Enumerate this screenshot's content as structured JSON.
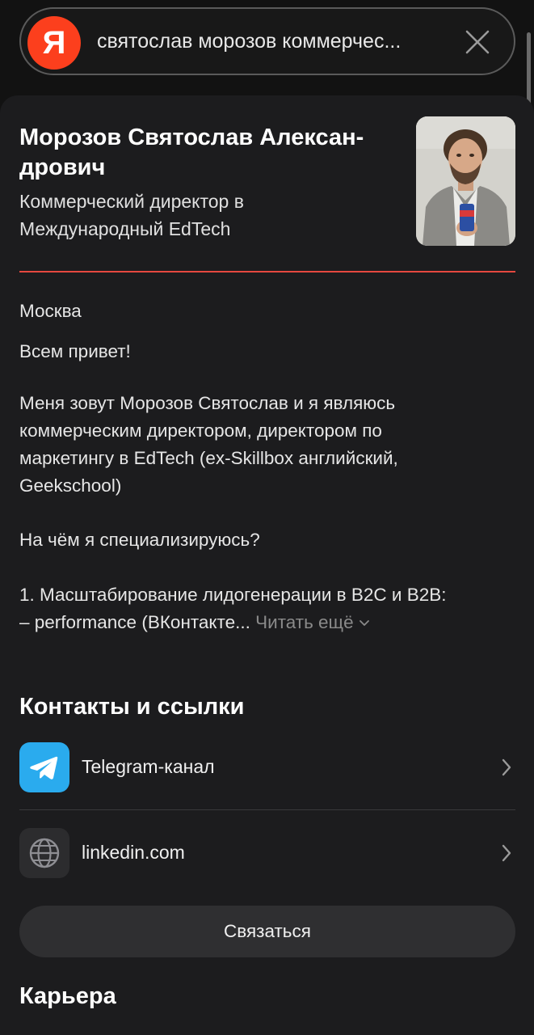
{
  "search": {
    "logo_letter": "Я",
    "query": "святослав морозов коммерчес..."
  },
  "profile": {
    "name": "Морозов Святослав Алексан-дрович",
    "name_line1": "Морозов Святослав Алексан-",
    "name_line2": "дрович",
    "role_line1": "Коммерческий директор в",
    "role_line2": "Международный EdTech",
    "city": "Москва",
    "greeting": "Всем привет!",
    "bio_lines": [
      "Меня зовут Морозов Святослав и я являюсь",
      "коммерческим директором, директором по",
      "маркетингу в EdTech (ex-Skillbox английский,",
      "Geekschool)"
    ],
    "question": "На чём я специализируюсь?",
    "point_line1": "1. Масштабирование лидогенерации в B2C и B2B:",
    "point_line2": "– performance (ВКонтакте...",
    "read_more": "Читать ещё"
  },
  "contacts": {
    "title": "Контакты и ссылки",
    "items": [
      {
        "label": "Telegram-канал",
        "icon": "telegram-icon"
      },
      {
        "label": "linkedin.com",
        "icon": "globe-icon"
      }
    ],
    "contact_button": "Связаться"
  },
  "career": {
    "title": "Карьера"
  },
  "colors": {
    "accent_red": "#e5483f",
    "logo_red": "#fc3f1d",
    "telegram_blue": "#2aabee"
  }
}
